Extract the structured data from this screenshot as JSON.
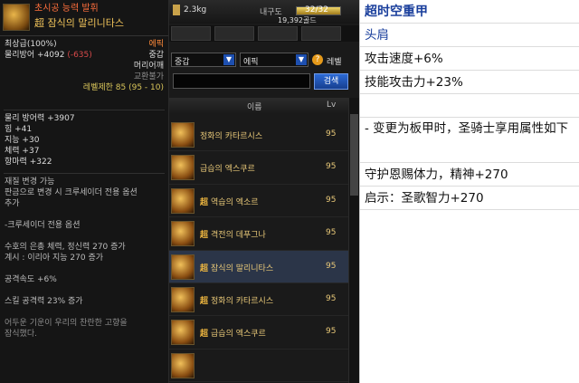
{
  "tooltip": {
    "title_tag": "초시공 능력 발휘",
    "item_name": "超 잠식의 말리니타스",
    "grade": "최상급(100%)",
    "rarity": "에픽",
    "phys_def_label": "물리방어 +4092",
    "phys_def_diff": "(-635)",
    "weight_class": "중갑",
    "slot": "머리어깨",
    "trade": "교환불가",
    "level_req": "레벨제한 85 (95 - 10)",
    "stats": [
      "물리 방어력 +3907",
      "힘 +41",
      "지능 +30",
      "체력 +37",
      "항마력 +322"
    ],
    "material_change": [
      "재질 변경 가능",
      "판금으로 변경 시 크루세이더 전용 옵션",
      "추가"
    ],
    "crusader_header": "-크루세이더 전용 옵션",
    "crusader_lines": [
      "수호의 은총 체력, 정신력 270 증가",
      "계시 : 이리아 지능 270 증가"
    ],
    "attack_speed": "공격속도 +6%",
    "skill_attack": "스킬 공격력 23% 증가",
    "flavor": [
      "어두운 기운이 우리의 찬란한 고향을",
      "잠식했다."
    ]
  },
  "window": {
    "weight": "2.3kg",
    "durability_label": "내구도",
    "durability_value": "32/32",
    "durability_fill": 1.0,
    "gold": "19,392골드",
    "filter_type": "중갑",
    "filter_rarity": "에픽",
    "level_label": "레벨",
    "search_button": "검색",
    "col_name": "이름",
    "col_level": "Lv",
    "items": [
      {
        "prefix": "",
        "name": "정화의 카타르시스",
        "lv": "95",
        "selected": false
      },
      {
        "prefix": "",
        "name": "급습의 엑스쿠르",
        "lv": "95",
        "selected": false
      },
      {
        "prefix": "超",
        "name": "역습의 엑소르",
        "lv": "95",
        "selected": false
      },
      {
        "prefix": "超",
        "name": "격전의 데푸그나",
        "lv": "95",
        "selected": false
      },
      {
        "prefix": "超",
        "name": "잠식의 말리니타스",
        "lv": "95",
        "selected": true
      },
      {
        "prefix": "超",
        "name": "정화의 카타르시스",
        "lv": "95",
        "selected": false
      },
      {
        "prefix": "超",
        "name": "급습의 엑스쿠르",
        "lv": "95",
        "selected": false
      },
      {
        "prefix": "",
        "name": "",
        "lv": "",
        "selected": false
      }
    ]
  },
  "note": {
    "title": "超时空重甲",
    "slot": "头肩",
    "line_attack_speed": "攻击速度+6%",
    "line_skill": "技能攻击力+23%",
    "line_change": "- 变更为板甲时，圣骑士享用属性如下",
    "line_guard": "守护恩赐体力，精神+270",
    "line_revelation": "启示：圣歌智力+270"
  }
}
